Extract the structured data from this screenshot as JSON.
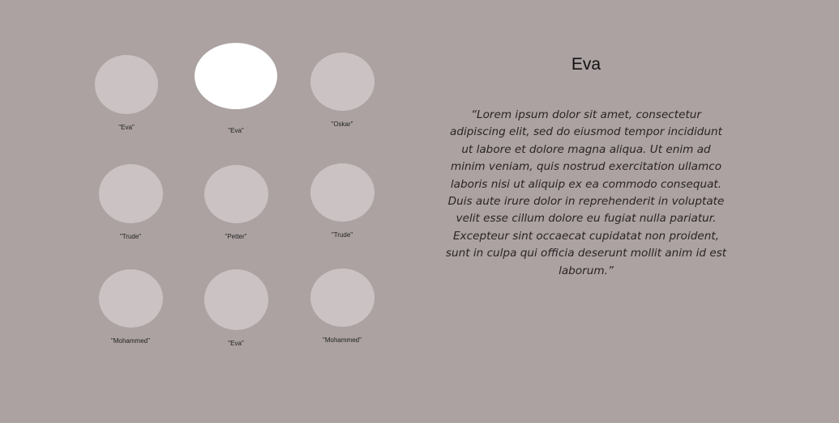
{
  "people": [
    {
      "name": "\"Eva\"",
      "active": false
    },
    {
      "name": "\"Eva\"",
      "active": true
    },
    {
      "name": "\"Oskar\"",
      "active": false
    },
    {
      "name": "\"Trude\"",
      "active": false
    },
    {
      "name": "\"Petter\"",
      "active": false
    },
    {
      "name": "\"Trude\"",
      "active": false
    },
    {
      "name": "\"Mohammed\"",
      "active": false
    },
    {
      "name": "\"Eva\"",
      "active": false
    },
    {
      "name": "\"Mohammed\"",
      "active": false
    }
  ],
  "detail": {
    "title": "Eva",
    "quote": [
      "“Lorem ipsum dolor sit amet, consectetur adipiscing elit, sed do eiusmod tempor incididunt ut labore et dolore magna aliqua. Ut enim ad minim veniam, quis nostrud exercitation ullamco laboris nisi ut aliquip ex ea commodo consequat.",
      "Duis aute irure dolor in reprehenderit in voluptate velit esse cillum dolore eu fugiat nulla pariatur.",
      "Excepteur sint occaecat cupidatat non proident, sunt in culpa qui officia deserunt mollit anim id est laborum.”"
    ]
  },
  "icons": {
    "avatar": "person-portrait-icon"
  },
  "colors": {
    "background": "#aca2a2",
    "avatar_inactive": "#cbc3c3",
    "avatar_active": "#ffffff"
  }
}
